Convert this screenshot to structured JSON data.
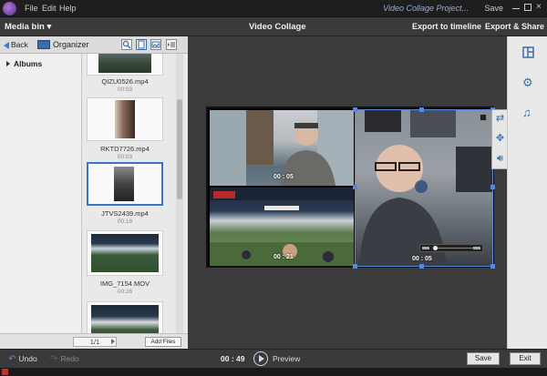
{
  "titlebar": {
    "menus": [
      "File",
      "Edit",
      "Help"
    ],
    "window_title": "Video Collage Project...",
    "save_label": "Save"
  },
  "header": {
    "media_bin": "Media bin",
    "title": "Video Collage",
    "export_timeline": "Export to timeline",
    "export_share": "Export & Share"
  },
  "media_panel": {
    "back_label": "Back",
    "organizer_label": "Organizer",
    "albums_label": "Albums",
    "thumbnails": [
      {
        "name": "QIZU0526.mp4",
        "duration": "00:03"
      },
      {
        "name": "RKTD7726.mp4",
        "duration": "00:03"
      },
      {
        "name": "JTVS2439.mp4",
        "duration": "00:18"
      },
      {
        "name": "IMG_7154.MOV",
        "duration": "00:26"
      },
      {
        "name": "",
        "duration": ""
      }
    ],
    "pager": "1/1",
    "add_files": "Add Files"
  },
  "collage": {
    "cells": [
      {
        "time": "00 : 05"
      },
      {
        "time": "00 : 21"
      },
      {
        "time": "00 : 05"
      }
    ],
    "active_cell": 3,
    "scrub_progress": 0.05
  },
  "bottombar": {
    "undo": "Undo",
    "redo": "Redo",
    "timecode": "00 : 49",
    "preview": "Preview",
    "save": "Save",
    "exit": "Exit"
  },
  "icons": {
    "right_panel": [
      "layout-icon",
      "settings-gear-icon",
      "music-note-icon"
    ],
    "cell_tools": [
      "swap-media-icon",
      "move-icon",
      "audio-icon"
    ]
  },
  "colors": {
    "accent": "#3a74c8",
    "stage_bg": "#3b3b3b",
    "panel_bg": "#e9e9e9"
  }
}
